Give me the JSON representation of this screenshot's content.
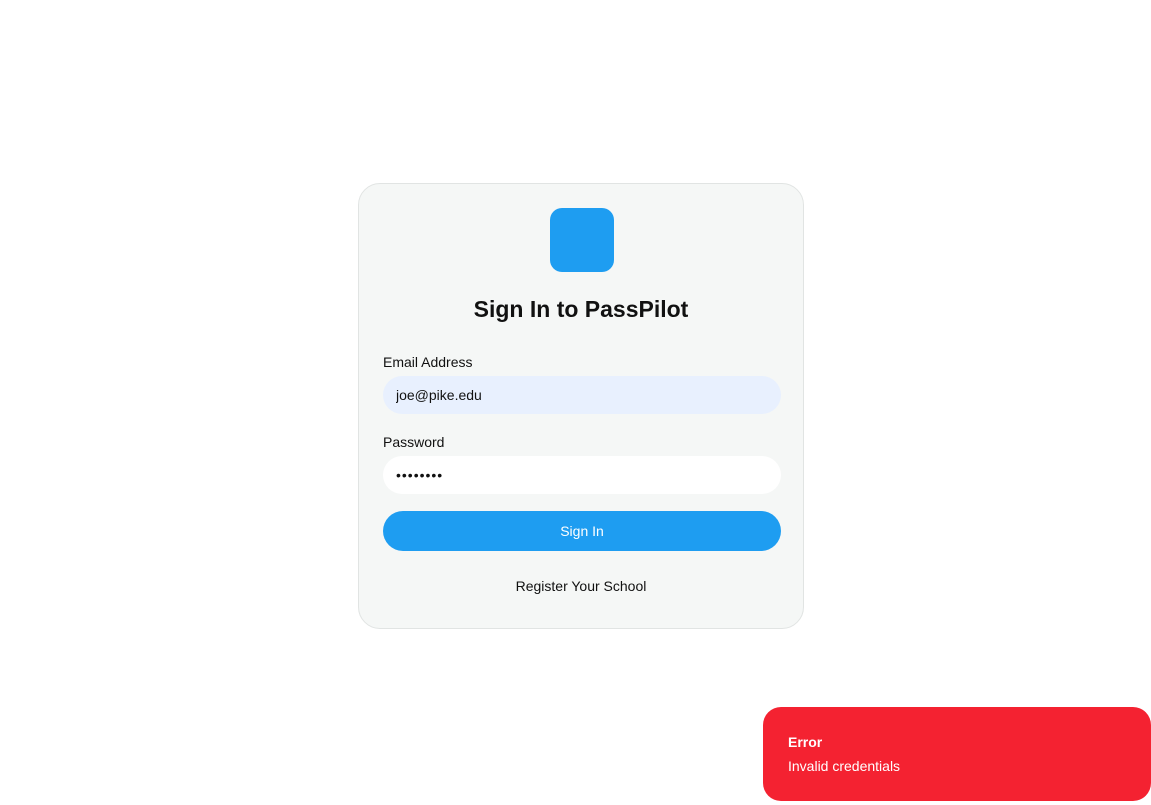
{
  "login": {
    "title": "Sign In to PassPilot",
    "email_label": "Email Address",
    "email_value": "joe@pike.edu",
    "password_label": "Password",
    "password_value": "secret12",
    "signin_label": "Sign In",
    "register_label": "Register Your School"
  },
  "toast": {
    "title": "Error",
    "message": "Invalid credentials"
  },
  "colors": {
    "accent": "#1e9df1",
    "error": "#f42231",
    "card_bg": "#f5f7f6",
    "email_field_bg": "#e8f0fe"
  }
}
